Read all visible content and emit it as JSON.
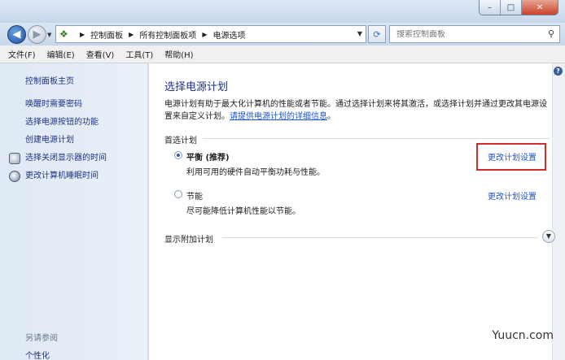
{
  "window": {
    "minimize_glyph": "–",
    "maximize_glyph": "□",
    "close_glyph": "✕"
  },
  "address": {
    "crumbs": [
      "控制面板",
      "所有控制面板项",
      "电源选项"
    ],
    "search_placeholder": "搜索控制面板"
  },
  "menu": {
    "items": [
      "文件(F)",
      "编辑(E)",
      "查看(V)",
      "工具(T)",
      "帮助(H)"
    ]
  },
  "sidebar": {
    "home": "控制面板主页",
    "links": [
      "唤醒时需要密码",
      "选择电源按钮的功能",
      "创建电源计划",
      "选择关闭显示器的时间",
      "更改计算机睡眠时间"
    ],
    "see_also": "另请参阅",
    "personalize": "个性化"
  },
  "main": {
    "title": "选择电源计划",
    "description": "电源计划有助于最大化计算机的性能或者节能。通过选择计划来将其激活，或选择计划并通过更改其电源设置来自定义计划。",
    "description_link": "请提供电源计划的详细信息",
    "description_end": "。",
    "preferred_label": "首选计划",
    "plans": [
      {
        "name": "平衡 (推荐)",
        "desc": "利用可用的硬件自动平衡功耗与性能。",
        "selected": true,
        "change_label": "更改计划设置"
      },
      {
        "name": "节能",
        "desc": "尽可能降低计算机性能以节能。",
        "selected": false,
        "change_label": "更改计划设置"
      }
    ],
    "additional_label": "显示附加计划"
  },
  "watermark": "Yuucn.com"
}
